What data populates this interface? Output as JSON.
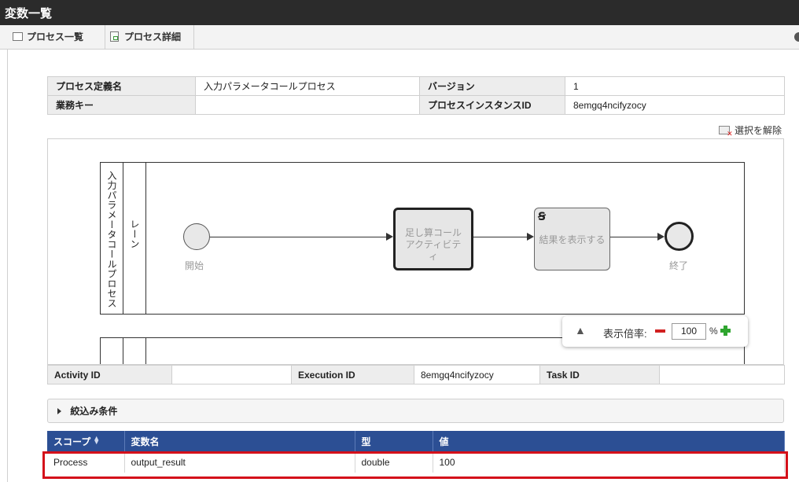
{
  "window": {
    "title": "変数一覧"
  },
  "tabs": [
    {
      "label": "プロセス一覧",
      "icon": "list-icon"
    },
    {
      "label": "プロセス詳細",
      "icon": "document-icon"
    }
  ],
  "process_info": {
    "process_def_name_label": "プロセス定義名",
    "process_def_name_value": "入力パラメータコールプロセス",
    "version_label": "バージョン",
    "version_value": "1",
    "business_key_label": "業務キー",
    "business_key_value": "",
    "instance_id_label": "プロセスインスタンスID",
    "instance_id_value": "8emgq4ncifyzocy"
  },
  "clear_selection": {
    "label": "選択を解除",
    "icon": "clear-selection-icon"
  },
  "diagram": {
    "pool_label": "入力パラメータコールプロセス",
    "lane_label": "レーン",
    "start_label": "開始",
    "task1_label": "足し算コールアクティビティ",
    "task2_label": "結果を表示する",
    "task2_icon": "script-task-icon",
    "end_label": "終了"
  },
  "zoom": {
    "label": "表示倍率:",
    "value": "100",
    "unit": "%"
  },
  "ids": {
    "activity_id_label": "Activity ID",
    "activity_id_value": "",
    "execution_id_label": "Execution ID",
    "execution_id_value": "8emgq4ncifyzocy",
    "task_id_label": "Task ID",
    "task_id_value": ""
  },
  "filter": {
    "label": "絞込み条件"
  },
  "variables": {
    "columns": [
      "スコープ",
      "変数名",
      "型",
      "値"
    ],
    "rows": [
      {
        "scope": "Process",
        "name": "output_result",
        "type": "double",
        "value": "100"
      }
    ]
  },
  "colors": {
    "header_bg": "#2c4f94",
    "highlight": "#d4101a",
    "zoom_minus": "#d12020",
    "zoom_plus": "#2fa52f"
  }
}
